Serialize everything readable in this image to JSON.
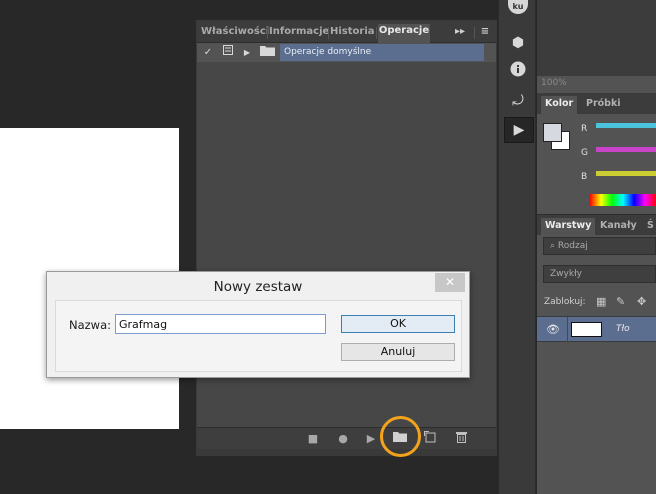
{
  "actions_panel": {
    "tabs": [
      "Właściwości",
      "Informacje",
      "Historia",
      "Operacje"
    ],
    "active_tab": "Operacje",
    "expand_icon": "double-chevron-right-icon",
    "menu_icon": "panel-menu-icon",
    "default_set": "Operacje domyślne",
    "bottom_icons": [
      "stop-icon",
      "record-icon",
      "play-icon",
      "new-set-folder-icon",
      "new-action-icon",
      "trash-icon"
    ]
  },
  "tool_strip": {
    "avatar_text": "ku",
    "icons": [
      "3d-cube-icon",
      "info-icon",
      "history-icon",
      "actions-play-icon"
    ]
  },
  "right_panel": {
    "zoom": "100%",
    "color_tabs": [
      "Kolor",
      "Próbki"
    ],
    "channels": [
      "R",
      "G",
      "B"
    ],
    "layer_tabs": [
      "Warstwy",
      "Kanały",
      "Ś"
    ],
    "filter_placeholder": "Rodzaj",
    "blend_mode": "Zwykły",
    "lock_label": "Zablokuj:",
    "layer_name": "Tło"
  },
  "dialog": {
    "title": "Nowy zestaw",
    "close": "✕",
    "name_label": "Nazwa:",
    "name_value": "Grafmag",
    "ok": "OK",
    "cancel": "Anuluj"
  },
  "colors": {
    "selection": "#5b6e8f",
    "highlight_ring": "#f3a21b",
    "slider_r": "#4cc3dd",
    "slider_g": "#c944c9",
    "slider_b": "#cccc33"
  }
}
